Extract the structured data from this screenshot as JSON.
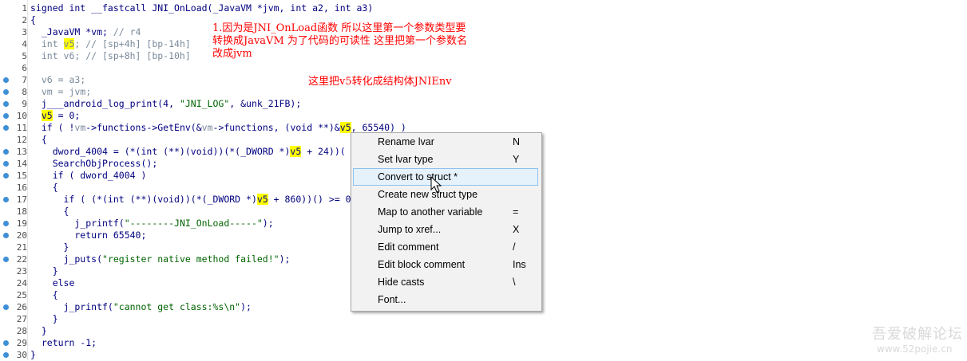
{
  "code": {
    "lines": [
      {
        "num": "1",
        "bp": false,
        "parts": [
          {
            "t": "signed int __fastcall JNI_OnLoad(_JavaVM *jvm, int a2, int a3)",
            "c": "k"
          }
        ]
      },
      {
        "num": "2",
        "bp": false,
        "parts": [
          {
            "t": "{",
            "c": "k"
          }
        ]
      },
      {
        "num": "3",
        "bp": false,
        "parts": [
          {
            "t": "  _JavaVM *vm; ",
            "c": "k"
          },
          {
            "t": "// r4",
            "c": "g"
          }
        ]
      },
      {
        "num": "4",
        "bp": false,
        "parts": [
          {
            "t": "  int ",
            "c": "g"
          },
          {
            "t": "v5",
            "c": "g",
            "hl": true
          },
          {
            "t": "; // [sp+4h] [bp-14h]",
            "c": "g"
          }
        ]
      },
      {
        "num": "5",
        "bp": false,
        "parts": [
          {
            "t": "  int v6; // [sp+8h] [bp-10h]",
            "c": "g"
          }
        ]
      },
      {
        "num": "6",
        "bp": false,
        "parts": []
      },
      {
        "num": "7",
        "bp": true,
        "parts": [
          {
            "t": "  v6 = a3;",
            "c": "g"
          }
        ]
      },
      {
        "num": "8",
        "bp": true,
        "parts": [
          {
            "t": "  vm = jvm;",
            "c": "g"
          }
        ]
      },
      {
        "num": "9",
        "bp": true,
        "parts": [
          {
            "t": "  j___android_log_print(4, ",
            "c": "k"
          },
          {
            "t": "\"JNI_LOG\"",
            "c": "s"
          },
          {
            "t": ", &unk_21FB);",
            "c": "k"
          }
        ]
      },
      {
        "num": "10",
        "bp": true,
        "parts": [
          {
            "t": "  ",
            "c": "k"
          },
          {
            "t": "v5",
            "c": "k",
            "hl": true
          },
          {
            "t": " = 0;",
            "c": "k"
          }
        ]
      },
      {
        "num": "11",
        "bp": true,
        "parts": [
          {
            "t": "  if ( !",
            "c": "k"
          },
          {
            "t": "vm",
            "c": "g"
          },
          {
            "t": "->functions->GetEnv(&",
            "c": "k"
          },
          {
            "t": "vm",
            "c": "g"
          },
          {
            "t": "->functions, (void **)&",
            "c": "k"
          },
          {
            "t": "v5",
            "c": "k",
            "hl": true
          },
          {
            "t": ", 65540) )",
            "c": "k"
          }
        ]
      },
      {
        "num": "12",
        "bp": false,
        "parts": [
          {
            "t": "  {",
            "c": "k"
          }
        ]
      },
      {
        "num": "13",
        "bp": true,
        "parts": [
          {
            "t": "    dword_4004 = (*(int (**)(void))(*(_DWORD *)",
            "c": "k"
          },
          {
            "t": "v5",
            "c": "k",
            "hl": true
          },
          {
            "t": " + 24))(",
            "c": "k"
          }
        ]
      },
      {
        "num": "14",
        "bp": true,
        "parts": [
          {
            "t": "    SearchObjProcess();",
            "c": "k"
          }
        ]
      },
      {
        "num": "15",
        "bp": true,
        "parts": [
          {
            "t": "    if ( dword_4004 )",
            "c": "k"
          }
        ]
      },
      {
        "num": "16",
        "bp": false,
        "parts": [
          {
            "t": "    {",
            "c": "k"
          }
        ]
      },
      {
        "num": "17",
        "bp": true,
        "parts": [
          {
            "t": "      if ( (*(int (**)(void))(*(_DWORD *)",
            "c": "k"
          },
          {
            "t": "v5",
            "c": "k",
            "hl": true
          },
          {
            "t": " + 860))() >= 0",
            "c": "k"
          }
        ]
      },
      {
        "num": "18",
        "bp": false,
        "parts": [
          {
            "t": "      {",
            "c": "k"
          }
        ]
      },
      {
        "num": "19",
        "bp": true,
        "parts": [
          {
            "t": "        j_printf(",
            "c": "k"
          },
          {
            "t": "\"--------JNI_OnLoad-----\"",
            "c": "s"
          },
          {
            "t": ");",
            "c": "k"
          }
        ]
      },
      {
        "num": "20",
        "bp": true,
        "parts": [
          {
            "t": "        return 65540;",
            "c": "k"
          }
        ]
      },
      {
        "num": "21",
        "bp": false,
        "parts": [
          {
            "t": "      }",
            "c": "k"
          }
        ]
      },
      {
        "num": "22",
        "bp": true,
        "parts": [
          {
            "t": "      j_puts(",
            "c": "k"
          },
          {
            "t": "\"register native method failed!\"",
            "c": "s"
          },
          {
            "t": ");",
            "c": "k"
          }
        ]
      },
      {
        "num": "23",
        "bp": false,
        "parts": [
          {
            "t": "    }",
            "c": "k"
          }
        ]
      },
      {
        "num": "24",
        "bp": false,
        "parts": [
          {
            "t": "    else",
            "c": "k"
          }
        ]
      },
      {
        "num": "25",
        "bp": false,
        "parts": [
          {
            "t": "    {",
            "c": "k"
          }
        ]
      },
      {
        "num": "26",
        "bp": true,
        "parts": [
          {
            "t": "      j_printf(",
            "c": "k"
          },
          {
            "t": "\"cannot get class:%s\\n\"",
            "c": "s"
          },
          {
            "t": ");",
            "c": "k"
          }
        ]
      },
      {
        "num": "27",
        "bp": false,
        "parts": [
          {
            "t": "    }",
            "c": "k"
          }
        ]
      },
      {
        "num": "28",
        "bp": false,
        "parts": [
          {
            "t": "  }",
            "c": "k"
          }
        ]
      },
      {
        "num": "29",
        "bp": true,
        "parts": [
          {
            "t": "  return -1;",
            "c": "k"
          }
        ]
      },
      {
        "num": "30",
        "bp": true,
        "parts": [
          {
            "t": "}",
            "c": "k"
          }
        ]
      }
    ]
  },
  "annotations": {
    "note1": "1.因为是JNI_OnLoad函数 所以这里第一个参数类型要\n转换成JavaVM 为了代码的可读性 这里把第一个参数名\n改成jvm",
    "note2": "这里把v5转化成结构体JNIEnv"
  },
  "context_menu": {
    "items": [
      {
        "label": "Rename lvar",
        "key": "N"
      },
      {
        "label": "Set lvar type",
        "key": "Y"
      },
      {
        "label": "Convert to struct *",
        "key": ""
      },
      {
        "label": "Create new struct type",
        "key": ""
      },
      {
        "label": "Map to another variable",
        "key": "="
      },
      {
        "label": "Jump to xref...",
        "key": "X"
      },
      {
        "label": "Edit comment",
        "key": "/"
      },
      {
        "label": "Edit block comment",
        "key": "Ins"
      },
      {
        "label": "Hide casts",
        "key": "\\"
      },
      {
        "label": "Font...",
        "key": ""
      }
    ],
    "active_index": 2
  },
  "watermark": {
    "title": "吾爱破解论坛",
    "url": "www.52pojie.cn"
  },
  "colors": {
    "keyword": "#000080",
    "grey_text": "#7a8a9a",
    "string": "#006400",
    "highlight": "#ffff00",
    "annotation": "#ff0000",
    "breakpoint": "#3f8fd6",
    "menu_hover": "#e5f1fb"
  }
}
